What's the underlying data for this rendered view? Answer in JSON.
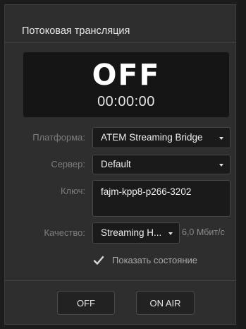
{
  "header": {
    "title": "Потоковая трансляция"
  },
  "status": {
    "state": "OFF",
    "time": "00:00:00"
  },
  "form": {
    "platform": {
      "label": "Платформа:",
      "value": "ATEM Streaming Bridge"
    },
    "server": {
      "label": "Сервер:",
      "value": "Default"
    },
    "key": {
      "label": "Ключ:",
      "value": "fajm-kpp8-p266-3202"
    },
    "quality": {
      "label": "Качество:",
      "value": "Streaming H...",
      "bitrate": "6,0 Мбит/с"
    },
    "show_status": {
      "label": "Показать состояние",
      "checked": true
    }
  },
  "buttons": {
    "off": "OFF",
    "on_air": "ON AIR"
  },
  "colors": {
    "panel": "#2e2e2e",
    "field": "#1a1a1a",
    "status_bg": "#151515"
  }
}
